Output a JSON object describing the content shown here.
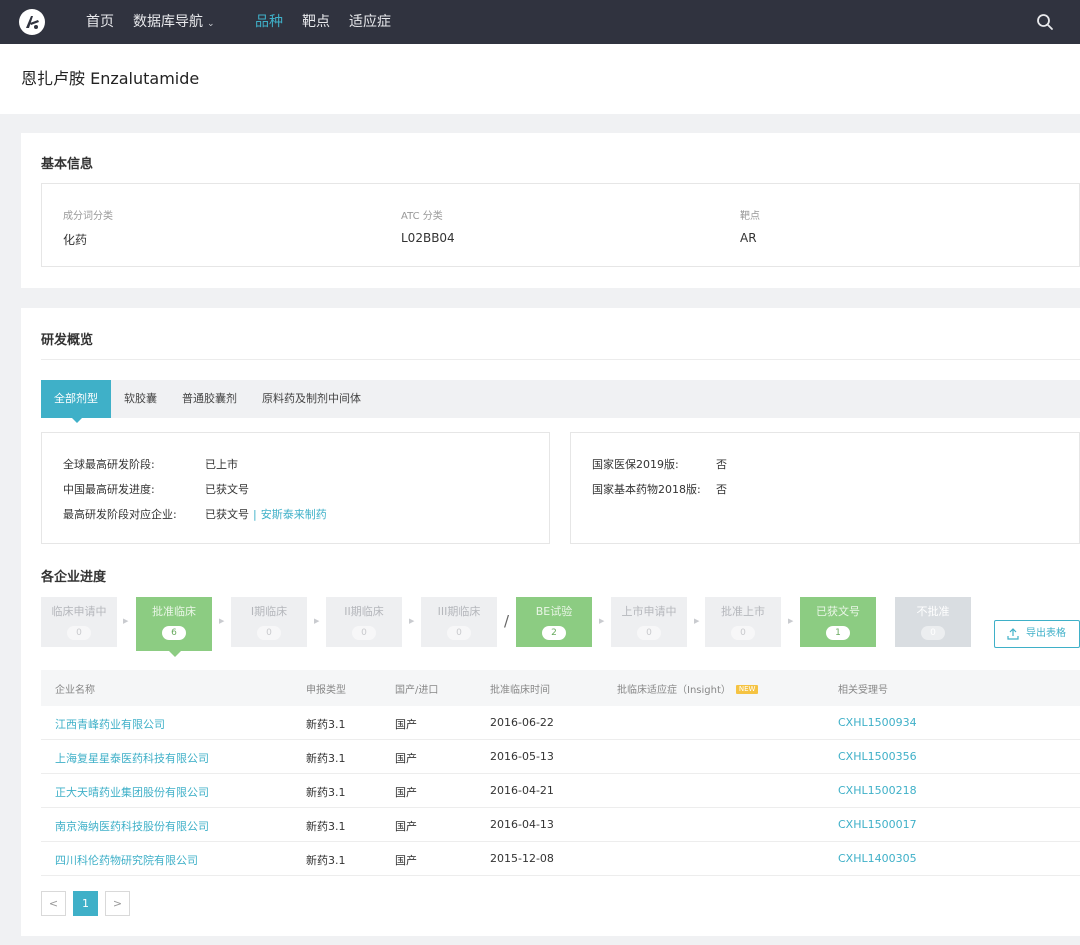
{
  "nav": {
    "items": [
      {
        "label": "首页",
        "active": false,
        "dropdown": false
      },
      {
        "label": "数据库导航",
        "active": false,
        "dropdown": true
      },
      {
        "label": "品种",
        "active": true,
        "dropdown": false
      },
      {
        "label": "靶点",
        "active": false,
        "dropdown": false
      },
      {
        "label": "适应症",
        "active": false,
        "dropdown": false
      }
    ],
    "search_icon": "search-icon",
    "dropdown_caret": "⌄"
  },
  "page_title": "恩扎卢胺 Enzalutamide",
  "basic_info": {
    "title": "基本信息",
    "fields": [
      {
        "label": "成分词分类",
        "value": "化药"
      },
      {
        "label": "ATC 分类",
        "value": "L02BB04"
      },
      {
        "label": "靶点",
        "value": "AR"
      }
    ]
  },
  "overview": {
    "title": "研发概览",
    "tabs": [
      "全部剂型",
      "软胶囊",
      "普通胶囊剂",
      "原料药及制剂中间体"
    ],
    "active_tab": 0,
    "left_details": [
      {
        "label": "全球最高研发阶段:",
        "value": "已上市"
      },
      {
        "label": "中国最高研发进度:",
        "value": "已获文号"
      },
      {
        "label": "最高研发阶段对应企业:",
        "value": "已获文号",
        "separator": "|",
        "link": "安斯泰来制药"
      }
    ],
    "right_details": [
      {
        "label": "国家医保2019版:",
        "value": "否"
      },
      {
        "label": "国家基本药物2018版:",
        "value": "否"
      }
    ]
  },
  "progress": {
    "title": "各企业进度",
    "stages": [
      {
        "name": "临床申请中",
        "count": "0",
        "state": "inactive"
      },
      {
        "name": "批准临床",
        "count": "6",
        "state": "active"
      },
      {
        "name": "I期临床",
        "count": "0",
        "state": "inactive"
      },
      {
        "name": "II期临床",
        "count": "0",
        "state": "inactive"
      },
      {
        "name": "III期临床",
        "count": "0",
        "state": "inactive"
      },
      {
        "name": "BE试验",
        "count": "2",
        "state": "active"
      },
      {
        "name": "上市申请中",
        "count": "0",
        "state": "inactive"
      },
      {
        "name": "批准上市",
        "count": "0",
        "state": "inactive"
      },
      {
        "name": "已获文号",
        "count": "1",
        "state": "active"
      },
      {
        "name": "不批准",
        "count": "0",
        "state": "rejected"
      }
    ],
    "selected_stage": 1,
    "slash": "/",
    "export_label": "导出表格"
  },
  "table": {
    "headers": [
      "企业名称",
      "申报类型",
      "国产/进口",
      "批准临床时间",
      "批临床适应症（Insight）",
      "相关受理号"
    ],
    "new_badge": "NEW",
    "rows": [
      {
        "company": "江西青峰药业有限公司",
        "type": "新药3.1",
        "origin": "国产",
        "date": "2016-06-22",
        "indication": "",
        "number": "CXHL1500934"
      },
      {
        "company": "上海复星星泰医药科技有限公司",
        "type": "新药3.1",
        "origin": "国产",
        "date": "2016-05-13",
        "indication": "",
        "number": "CXHL1500356"
      },
      {
        "company": "正大天晴药业集团股份有限公司",
        "type": "新药3.1",
        "origin": "国产",
        "date": "2016-04-21",
        "indication": "",
        "number": "CXHL1500218"
      },
      {
        "company": "南京海纳医药科技股份有限公司",
        "type": "新药3.1",
        "origin": "国产",
        "date": "2016-04-13",
        "indication": "",
        "number": "CXHL1500017"
      },
      {
        "company": "四川科伦药物研究院有限公司",
        "type": "新药3.1",
        "origin": "国产",
        "date": "2015-12-08",
        "indication": "",
        "number": "CXHL1400305"
      }
    ]
  },
  "pagination": {
    "prev": "<",
    "current": "1",
    "next": ">"
  },
  "colors": {
    "accent": "#3fb0c8",
    "stage_active": "#8ccc82",
    "topbar": "#30333f"
  }
}
